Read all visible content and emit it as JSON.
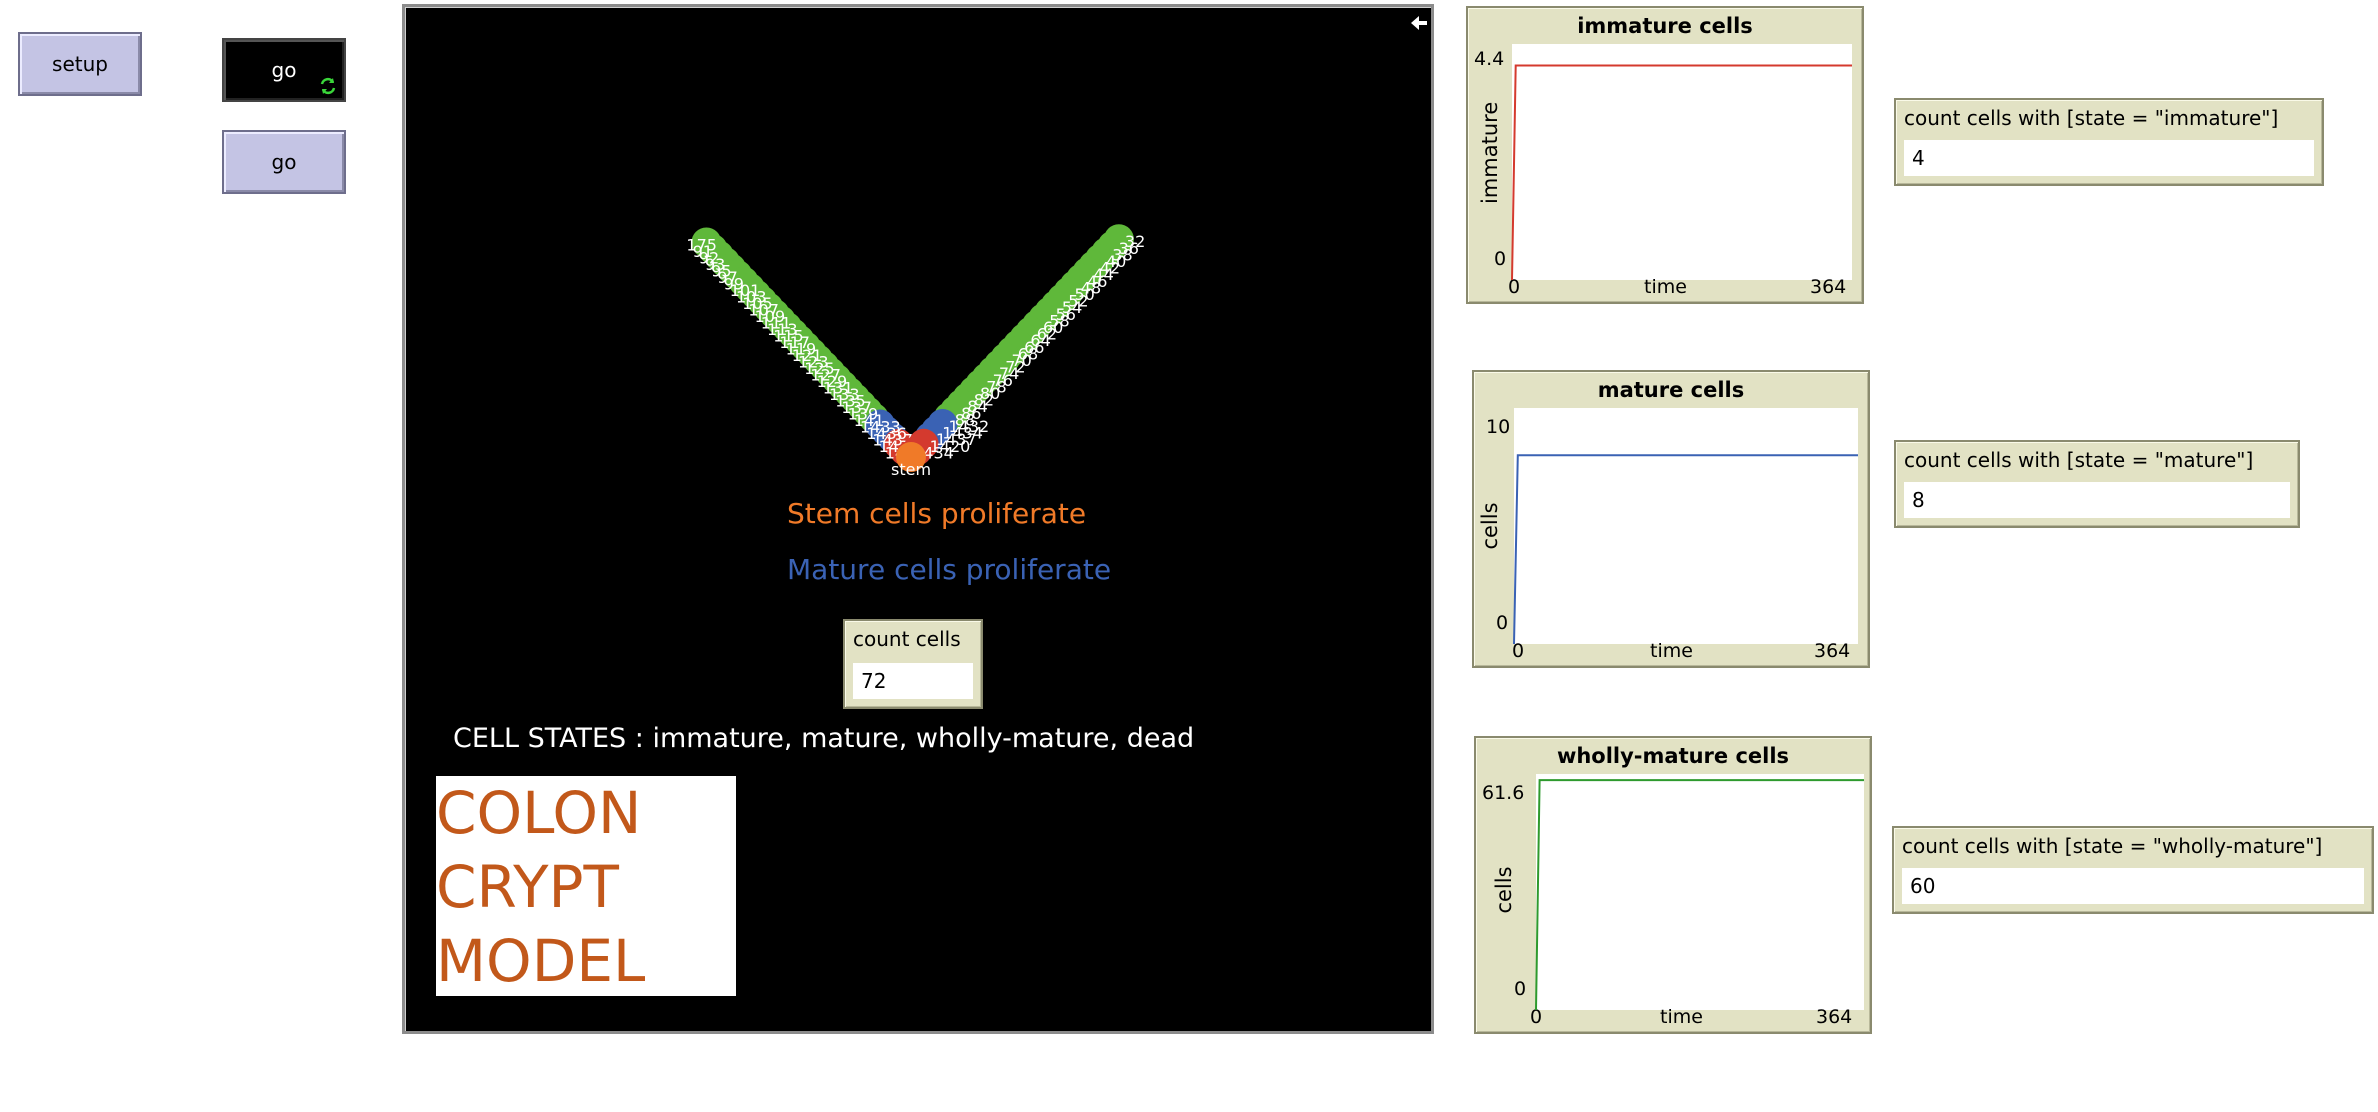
{
  "buttons": {
    "setup": "setup",
    "go_forever": "go",
    "go_once": "go"
  },
  "view": {
    "stem_label": "stem",
    "stem_text": "Stem cells proliferate",
    "mature_text": "Mature cells proliferate",
    "states_text": "CELL STATES : immature, mature, wholly-mature, dead",
    "count_monitor": {
      "label": "count cells",
      "value": "72"
    },
    "title_lines": [
      "COLON",
      "CRYPT",
      "MODEL"
    ],
    "colors": {
      "stem": "#f07a28",
      "immature": "#d43a2e",
      "mature": "#3a62b4",
      "wholly_mature": "#5fb83a"
    },
    "left_arm": {
      "labels": [
        "1435",
        "1431",
        "1437",
        "1436",
        "1433",
        "141",
        "139",
        "137",
        "135",
        "133",
        "131",
        "129",
        "127",
        "125",
        "123",
        "121",
        "119",
        "117",
        "115",
        "113",
        "111",
        "109",
        "107",
        "105",
        "103",
        "101",
        "99",
        "97",
        "95",
        "93",
        "92",
        "91",
        "175"
      ],
      "states": [
        "immature",
        "immature",
        "mature",
        "mature",
        "mature",
        "wholly-mature",
        "wholly-mature",
        "wholly-mature",
        "wholly-mature",
        "wholly-mature",
        "wholly-mature",
        "wholly-mature",
        "wholly-mature",
        "wholly-mature",
        "wholly-mature",
        "wholly-mature",
        "wholly-mature",
        "wholly-mature",
        "wholly-mature",
        "wholly-mature",
        "wholly-mature",
        "wholly-mature",
        "wholly-mature",
        "wholly-mature",
        "wholly-mature",
        "wholly-mature",
        "wholly-mature",
        "wholly-mature",
        "wholly-mature",
        "wholly-mature",
        "wholly-mature",
        "wholly-mature",
        "wholly-mature"
      ]
    },
    "right_arm": {
      "labels": [
        "434",
        "1420",
        "1437",
        "1434",
        "1432",
        "88",
        "86",
        "84",
        "82",
        "80",
        "78",
        "76",
        "74",
        "72",
        "70",
        "68",
        "66",
        "64",
        "62",
        "60",
        "58",
        "56",
        "54",
        "52",
        "50",
        "48",
        "46",
        "44",
        "42",
        "40",
        "38",
        "36",
        "32"
      ],
      "states": [
        "immature",
        "immature",
        "mature",
        "mature",
        "mature",
        "wholly-mature",
        "wholly-mature",
        "wholly-mature",
        "wholly-mature",
        "wholly-mature",
        "wholly-mature",
        "wholly-mature",
        "wholly-mature",
        "wholly-mature",
        "wholly-mature",
        "wholly-mature",
        "wholly-mature",
        "wholly-mature",
        "wholly-mature",
        "wholly-mature",
        "wholly-mature",
        "wholly-mature",
        "wholly-mature",
        "wholly-mature",
        "wholly-mature",
        "wholly-mature",
        "wholly-mature",
        "wholly-mature",
        "wholly-mature",
        "wholly-mature",
        "wholly-mature",
        "wholly-mature",
        "wholly-mature"
      ]
    }
  },
  "plots": [
    {
      "title": "immature cells",
      "ylabel": "immature",
      "xlabel": "time",
      "xmin": "0",
      "xmax": "364",
      "ymin": "0",
      "ymax": "4.4",
      "color": "#d43a2e",
      "series": {
        "x": [
          0,
          4,
          364
        ],
        "y": [
          0,
          4,
          4
        ],
        "xlim": [
          0,
          364
        ],
        "ylim": [
          0,
          4.4
        ]
      }
    },
    {
      "title": "mature cells",
      "ylabel": "cells",
      "xlabel": "time",
      "xmin": "0",
      "xmax": "364",
      "ymin": "0",
      "ymax": "10",
      "color": "#3a62b4",
      "series": {
        "x": [
          0,
          4,
          364
        ],
        "y": [
          0,
          8,
          8
        ],
        "xlim": [
          0,
          364
        ],
        "ylim": [
          0,
          10
        ]
      }
    },
    {
      "title": "wholly-mature cells",
      "ylabel": "cells",
      "xlabel": "time",
      "xmin": "0",
      "xmax": "364",
      "ymin": "0",
      "ymax": "61.6",
      "color": "#2e9a2e",
      "series": {
        "x": [
          0,
          4,
          364
        ],
        "y": [
          0,
          60,
          60
        ],
        "xlim": [
          0,
          364
        ],
        "ylim": [
          0,
          61.6
        ]
      }
    }
  ],
  "monitors": [
    {
      "label": "count cells with [state = \"immature\"]",
      "value": "4"
    },
    {
      "label": "count cells with [state = \"mature\"]",
      "value": "8"
    },
    {
      "label": "count cells with [state = \"wholly-mature\"]",
      "value": "60"
    }
  ]
}
